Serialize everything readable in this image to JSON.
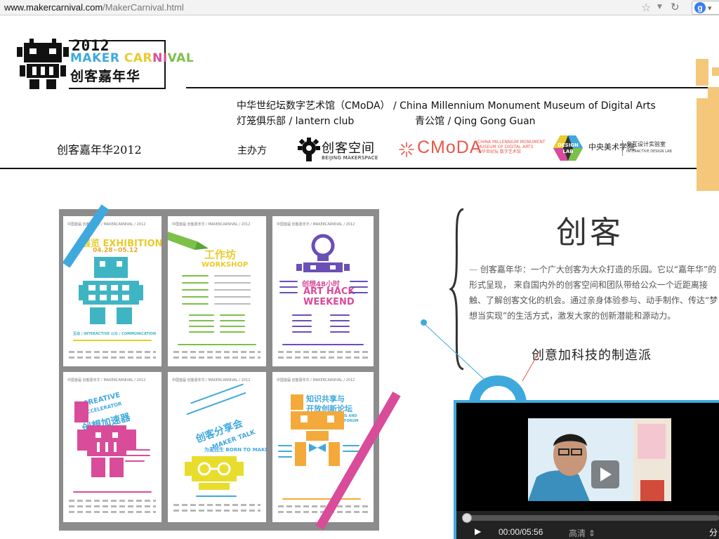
{
  "browser": {
    "url_domain": "www.makercarnival.com",
    "url_path": "/MakerCarnival.html"
  },
  "logo": {
    "year": "2012",
    "word1": "MAKER",
    "word2a": "CAR",
    "word2b": "NI",
    "word2c": "VAL",
    "chinese": "创客嘉年华"
  },
  "header": {
    "org_line1": "中华世纪坛数字艺术馆（CMoDA） / China Millennium Monument Museum of Digital Arts",
    "org_line2a": "灯笼俱乐部 / lantern club",
    "org_line2b": "青公馆 / Qing Gong Guan",
    "brand_title": "创客嘉年华2012",
    "host_label": "主办方",
    "sponsors": {
      "beijing_makerspace_cn": "创客空间",
      "beijing_makerspace_en": "BEIJING MAKERSPACE",
      "cmoda": "CMoDA",
      "cmoda_small_1": "CHINA MILLENNIUM MONUMENT",
      "cmoda_small_2": "MUSEUM OF DIGITAL ARTS",
      "cmoda_small_3": "中华世纪坛 数字艺术馆",
      "design_badge_1": "DESIGN",
      "design_badge_2": "LAB",
      "cafa": "中央美术学院",
      "lab_cn": "交互设计实验室",
      "lab_en": "INTERACTIVE DESIGN LAB"
    }
  },
  "posters": {
    "p1": {
      "header": "中国首届 创客嘉年华 / MAKERCARNIVAL / 2012",
      "title": "展览 EXHIBITION",
      "date": "04.28~05.12",
      "tag": "互动 / INTERACTIVE  公众 / COMMUNICATION"
    },
    "p2": {
      "header": "中国首届 创客嘉年华 / MAKERCARNIVAL / 2012",
      "title": "工作坊",
      "sub": "WORKSHOP"
    },
    "p3": {
      "header": "中国首届 创客嘉年华 / MAKERCARNIVAL / 2012",
      "title": "创想48小时",
      "sub1": "ART HACK",
      "sub2": "WEEKEND"
    },
    "p4": {
      "header": "中国首届 创客嘉年华 / MAKERCARNIVAL / 2012",
      "title1": "CREATIVE",
      "title2": "ACCELERATOR",
      "title3": "创想加速器"
    },
    "p5": {
      "header": "中国首届 创客嘉年华 / MAKERCARNIVAL / 2012",
      "title": "创客分享会",
      "sub": "MAKER TALK",
      "sub2": "为麦而生 BORN TO MAKE"
    },
    "p6": {
      "header": "中国首届 创客嘉年华 / MAKERCARNIVAL / 2012",
      "title1": "知识共享与",
      "title2": "开放创新论坛",
      "sub1": "CREATIVE COMMONS AND",
      "sub2": "OPEN INNOVATION FORUM"
    }
  },
  "content": {
    "heading": "创客",
    "intro_dash": "—",
    "intro": "创客嘉年华：一个广大创客为大众打造的乐园。它以“嘉年华”的形式呈现， 来自国内外的创客空间和团队带给公众一个近距离接触、了解创客文化的机会。通过亲身体验参与、动手制作、传达“梦想当实现”的生活方式，激发大家的创新潜能和源动力。",
    "slogan": "创意加科技的制造派"
  },
  "video": {
    "time": "00:00/05:56",
    "quality": "高清 ⇕",
    "share": "分"
  },
  "colors": {
    "blue": "#3fa9dd",
    "yellow": "#e8cc2c",
    "pink": "#d94c9a",
    "green": "#7cc04a",
    "purple": "#6a4fb6",
    "orange": "#f4a93b",
    "cmoda_red": "#e6584b",
    "deco_orange": "#f4c77a"
  }
}
